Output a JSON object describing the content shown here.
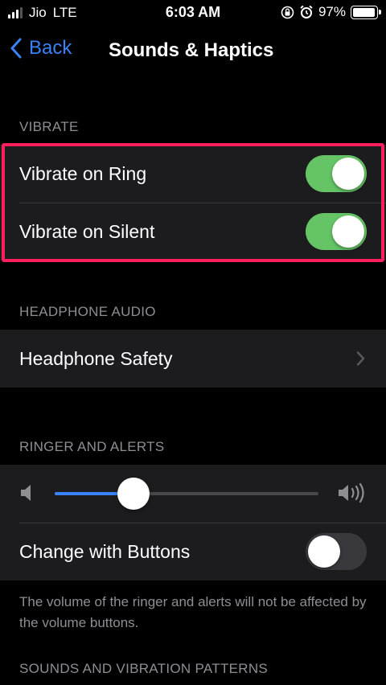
{
  "status_bar": {
    "carrier": "Jio",
    "network": "LTE",
    "time": "6:03 AM",
    "battery_percent": "97%",
    "battery_level": 0.97,
    "signal_bars_active": 3,
    "signal_bars_total": 4,
    "icons": [
      "orientation-lock-icon",
      "alarm-icon",
      "battery-icon"
    ]
  },
  "nav": {
    "back_label": "Back",
    "title": "Sounds & Haptics"
  },
  "sections": {
    "vibrate": {
      "header": "VIBRATE",
      "rows": [
        {
          "label": "Vibrate on Ring",
          "on": true
        },
        {
          "label": "Vibrate on Silent",
          "on": true
        }
      ]
    },
    "headphone_audio": {
      "header": "HEADPHONE AUDIO",
      "rows": [
        {
          "label": "Headphone Safety"
        }
      ]
    },
    "ringer_alerts": {
      "header": "RINGER AND ALERTS",
      "volume_level": 0.3,
      "change_with_buttons": {
        "label": "Change with Buttons",
        "on": false
      },
      "note": "The volume of the ringer and alerts will not be affected by the volume buttons."
    },
    "patterns": {
      "header": "SOUNDS AND VIBRATION PATTERNS"
    }
  },
  "colors": {
    "accent": "#3a82f7",
    "toggle_on": "#65c466",
    "highlight": "#ff1f5a"
  }
}
